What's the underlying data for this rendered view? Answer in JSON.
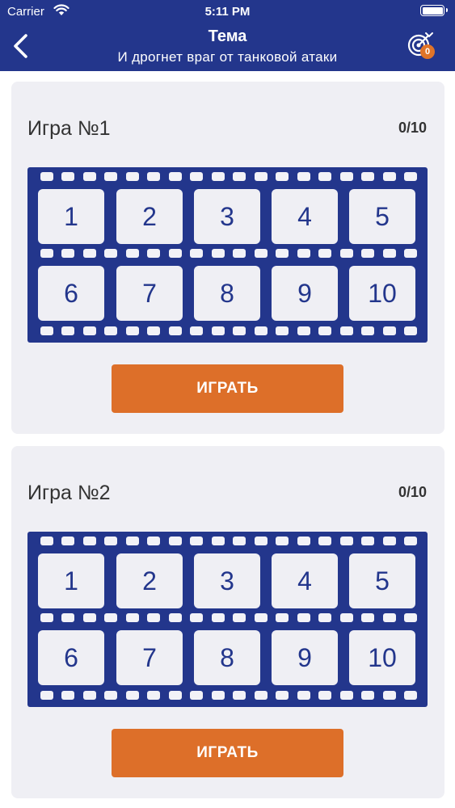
{
  "status_bar": {
    "carrier": "Carrier",
    "time": "5:11 PM"
  },
  "nav": {
    "title": "Тема",
    "subtitle": "И дрогнет враг от танковой атаки",
    "back_icon": "chevron-left-icon",
    "target_icon": "target-icon",
    "target_badge": "0"
  },
  "colors": {
    "header": "#23368c",
    "accent": "#dd6f29",
    "film": "#23368c",
    "card": "#efeff4"
  },
  "games": [
    {
      "title": "Игра №1",
      "score": "0/10",
      "frames": [
        "1",
        "2",
        "3",
        "4",
        "5",
        "6",
        "7",
        "8",
        "9",
        "10"
      ],
      "play_label": "ИГРАТЬ"
    },
    {
      "title": "Игра №2",
      "score": "0/10",
      "frames": [
        "1",
        "2",
        "3",
        "4",
        "5",
        "6",
        "7",
        "8",
        "9",
        "10"
      ],
      "play_label": "ИГРАТЬ"
    }
  ]
}
